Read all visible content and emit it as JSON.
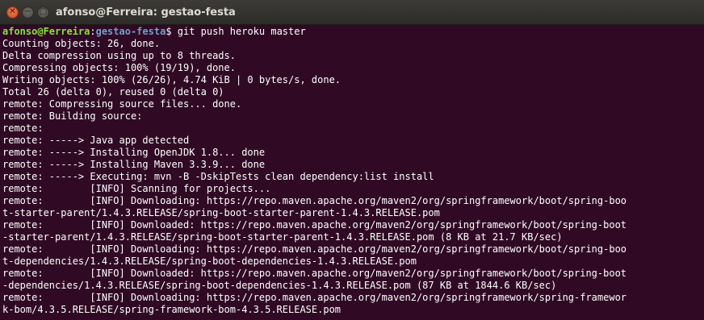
{
  "window": {
    "title": "afonso@Ferreira: gestao-festa",
    "close_glyph": "✕",
    "minimize_glyph": "−",
    "maximize_glyph": "□"
  },
  "prompt": {
    "user_host": "afonso@Ferreira",
    "sep": ":",
    "path": "gestao-festa",
    "symbol": "$ ",
    "command": "git push heroku master"
  },
  "output": [
    "Counting objects: 26, done.",
    "Delta compression using up to 8 threads.",
    "Compressing objects: 100% (19/19), done.",
    "Writing objects: 100% (26/26), 4.74 KiB | 0 bytes/s, done.",
    "Total 26 (delta 0), reused 0 (delta 0)",
    "remote: Compressing source files... done.",
    "remote: Building source:",
    "remote:",
    "remote: -----> Java app detected",
    "remote: -----> Installing OpenJDK 1.8... done",
    "remote: -----> Installing Maven 3.3.9... done",
    "remote: -----> Executing: mvn -B -DskipTests clean dependency:list install",
    "remote:        [INFO] Scanning for projects...",
    "remote:        [INFO] Downloading: https://repo.maven.apache.org/maven2/org/springframework/boot/spring-boo",
    "t-starter-parent/1.4.3.RELEASE/spring-boot-starter-parent-1.4.3.RELEASE.pom",
    "remote:        [INFO] Downloaded: https://repo.maven.apache.org/maven2/org/springframework/boot/spring-boot",
    "-starter-parent/1.4.3.RELEASE/spring-boot-starter-parent-1.4.3.RELEASE.pom (8 KB at 21.7 KB/sec)",
    "remote:        [INFO] Downloading: https://repo.maven.apache.org/maven2/org/springframework/boot/spring-boo",
    "t-dependencies/1.4.3.RELEASE/spring-boot-dependencies-1.4.3.RELEASE.pom",
    "remote:        [INFO] Downloaded: https://repo.maven.apache.org/maven2/org/springframework/boot/spring-boot",
    "-dependencies/1.4.3.RELEASE/spring-boot-dependencies-1.4.3.RELEASE.pom (87 KB at 1844.6 KB/sec)",
    "remote:        [INFO] Downloading: https://repo.maven.apache.org/maven2/org/springframework/spring-framewor",
    "k-bom/4.3.5.RELEASE/spring-framework-bom-4.3.5.RELEASE.pom"
  ]
}
